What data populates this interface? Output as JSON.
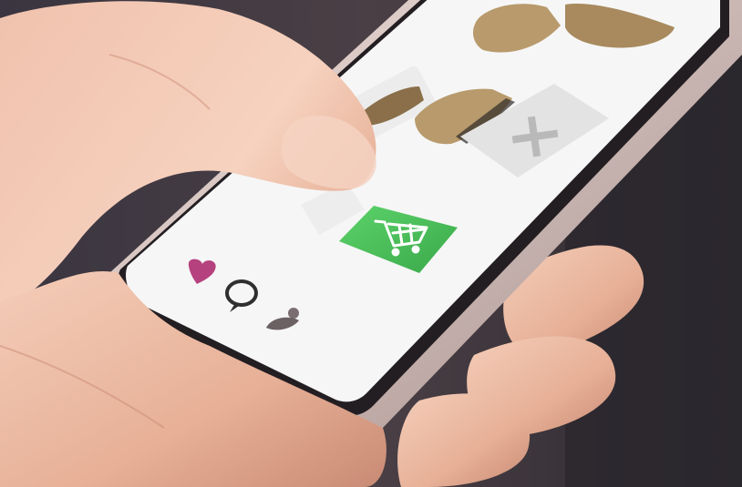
{
  "scene": {
    "description_tag": "",
    "colors": {
      "background_dark": "#2c2a33",
      "background_mid": "#4a3f45",
      "skin_light": "#f2c9b6",
      "skin_mid": "#e6ad95",
      "skin_shadow": "#c98a74",
      "phone_frame": "#2a2428",
      "phone_edge": "#d9c5c2",
      "screen_bg": "#f6f6f6",
      "cart_green": "#4cc25a",
      "like_color": "#b5427f",
      "search_color": "#2f2f2f",
      "profile_color": "#7a6e70",
      "boot_tan": "#b89a6c",
      "add_tile": "#e3e3e3"
    }
  },
  "app": {
    "products": [
      {
        "icon": "boot-pair-icon"
      },
      {
        "icon": "boot-icon"
      },
      {
        "icon": "boot-icon"
      }
    ],
    "add_tile_icon": "plus-icon",
    "cart_button_icon": "shopping-cart-icon",
    "bottom_nav": [
      {
        "icon": "heart-icon"
      },
      {
        "icon": "search-icon"
      },
      {
        "icon": "profile-icon"
      }
    ]
  }
}
